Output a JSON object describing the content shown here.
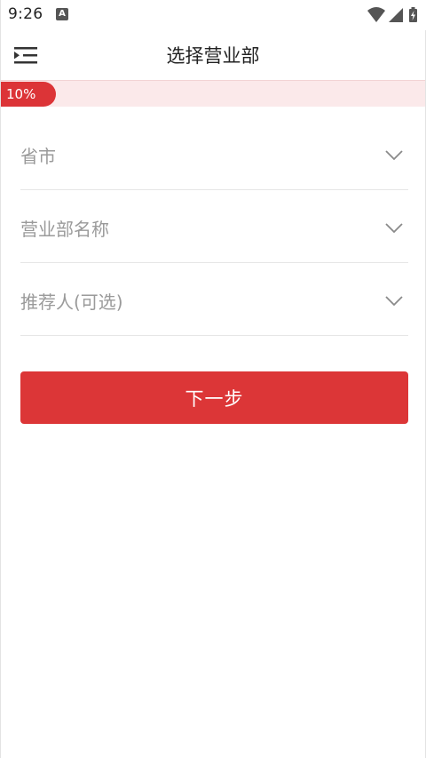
{
  "status_bar": {
    "time": "9:26",
    "notification_icon": "a-icon",
    "icons": [
      "wifi-icon",
      "signal-icon",
      "battery-charging-icon"
    ]
  },
  "header": {
    "title": "选择营业部",
    "menu_icon": "menu-collapse-icon"
  },
  "progress": {
    "label": "10%",
    "percent": 10,
    "color": "#dc3437",
    "track_color": "#fbe9ea"
  },
  "form": {
    "fields": [
      {
        "label": "省市"
      },
      {
        "label": "营业部名称"
      },
      {
        "label": "推荐人(可选)"
      }
    ],
    "chevron_icon": "chevron-down-icon"
  },
  "actions": {
    "next_label": "下一步",
    "accent": "#dc3637"
  }
}
